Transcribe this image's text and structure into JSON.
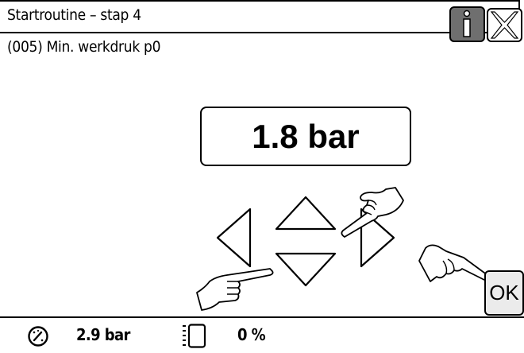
{
  "header": {
    "title": "Startroutine – stap 4",
    "info_icon": "info-icon",
    "close_icon": "close-icon"
  },
  "parameter": {
    "label": "(005) Min. werkdruk p0",
    "value": "1.8 bar"
  },
  "controls": {
    "ok_label": "OK",
    "left_icon": "arrow-left-icon",
    "right_icon": "arrow-right-icon",
    "up_icon": "arrow-up-icon",
    "down_icon": "arrow-down-icon"
  },
  "status": {
    "pressure": "2.9 bar",
    "level": "0 %",
    "pressure_icon": "gauge-icon",
    "level_icon": "tank-level-icon"
  }
}
